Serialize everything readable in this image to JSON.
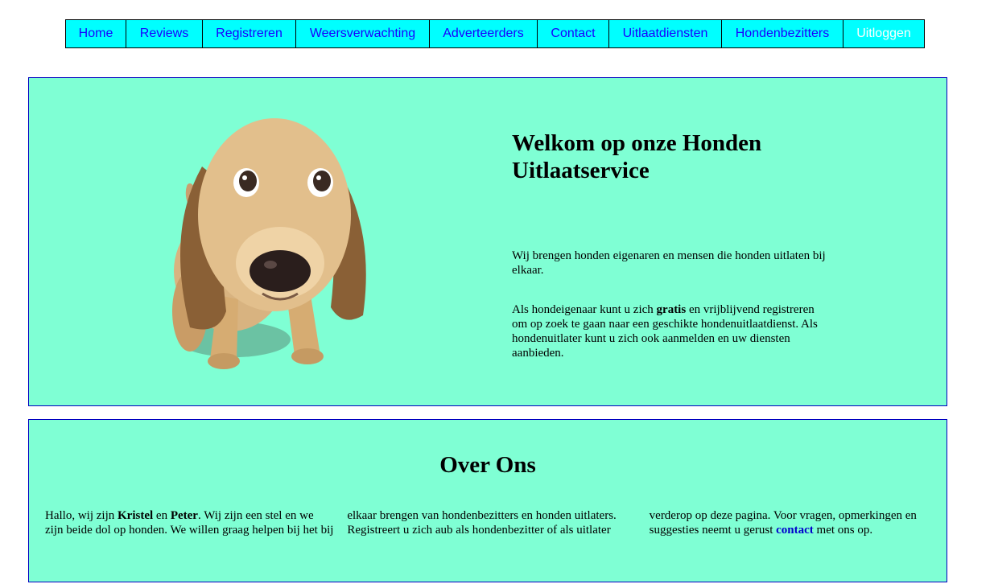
{
  "nav": {
    "items": [
      {
        "label": "Home"
      },
      {
        "label": "Reviews"
      },
      {
        "label": "Registreren"
      },
      {
        "label": "Weersverwachting"
      },
      {
        "label": "Adverteerders"
      },
      {
        "label": "Contact"
      },
      {
        "label": "Uitlaatdiensten"
      },
      {
        "label": "Hondenbezitters"
      },
      {
        "label": "Uitloggen"
      }
    ]
  },
  "hero": {
    "title": "Welkom op onze Honden Uitlaatservice",
    "p1": "Wij brengen honden eigenaren en mensen die honden uitlaten bij elkaar.",
    "p2_before": "Als hondeigenaar kunt u zich ",
    "p2_bold": "gratis",
    "p2_after": " en vrijblijvend registreren om op zoek te gaan naar een geschikte hondenuitlaatdienst. Als hondenuitlater kunt u zich ook aanmelden en uw diensten aanbieden."
  },
  "about": {
    "title": "Over Ons",
    "t1": "Hallo, wij zijn ",
    "name1": "Kristel",
    "t2": " en ",
    "name2": "Peter",
    "t3": ". Wij zijn een stel en we zijn beide dol op honden. We willen graag helpen bij het bij elkaar brengen van hondenbezitters en honden uitlaters. Registreert u zich aub als hondenbezitter of als uitlater verderop op deze pagina. Voor vragen, opmerkingen en suggesties neemt u gerust ",
    "link": "contact",
    "t4": " met ons op."
  },
  "colors": {
    "nav_bg": "#00ffff",
    "nav_text": "#1a00ff",
    "panel_bg": "#7fffd4",
    "panel_border": "#0000c0"
  },
  "icons": {
    "hero_image": "puppy-dog-image"
  }
}
